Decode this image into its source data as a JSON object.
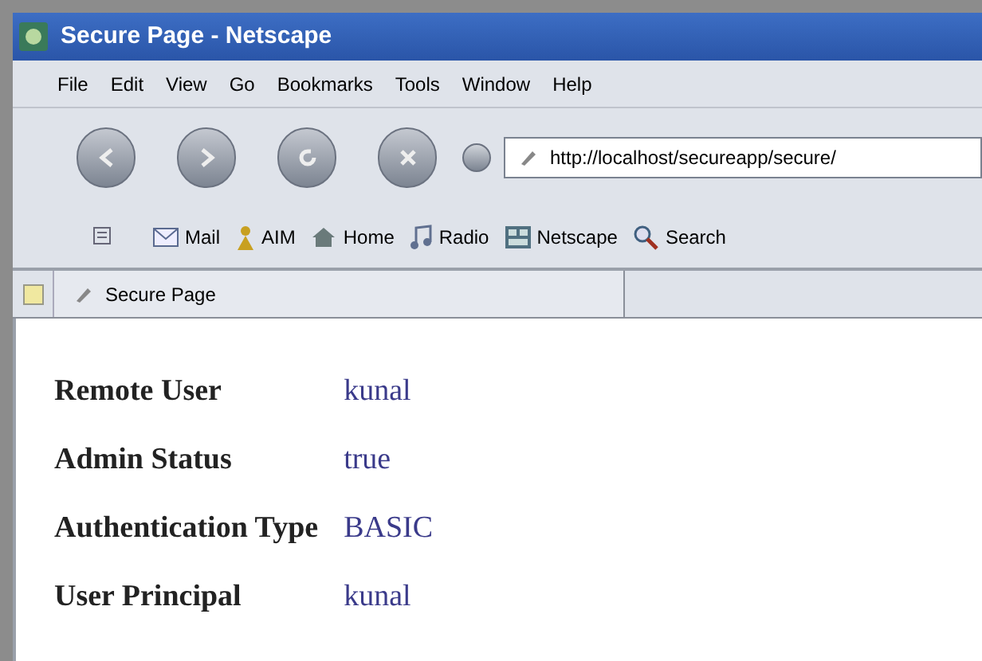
{
  "window": {
    "title": "Secure Page - Netscape"
  },
  "menu": [
    "File",
    "Edit",
    "View",
    "Go",
    "Bookmarks",
    "Tools",
    "Window",
    "Help"
  ],
  "address": {
    "value": "http://localhost/secureapp/secure/"
  },
  "bookmarks": [
    {
      "kind": "mail",
      "label": "Mail"
    },
    {
      "kind": "aim",
      "label": "AIM"
    },
    {
      "kind": "home",
      "label": "Home"
    },
    {
      "kind": "radio",
      "label": "Radio"
    },
    {
      "kind": "netscape",
      "label": "Netscape"
    },
    {
      "kind": "search",
      "label": "Search"
    }
  ],
  "tabs": [
    {
      "label": "Secure Page",
      "selected": true
    }
  ],
  "content": {
    "rows": [
      {
        "label": "Remote User",
        "value": "kunal"
      },
      {
        "label": "Admin Status",
        "value": "true"
      },
      {
        "label": "Authentication Type",
        "value": "BASIC"
      },
      {
        "label": "User Principal",
        "value": "kunal"
      }
    ]
  }
}
